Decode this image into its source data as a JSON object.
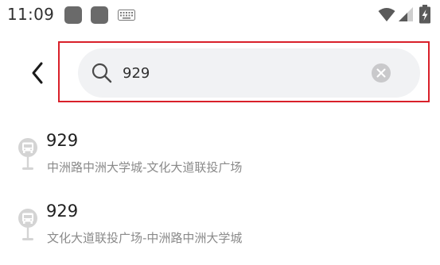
{
  "status_bar": {
    "time": "11:09"
  },
  "search": {
    "query": "929"
  },
  "results": [
    {
      "title": "929",
      "subtitle": "中洲路中洲大学城-文化大道联投广场",
      "icon": "bus-stop-icon"
    },
    {
      "title": "929",
      "subtitle": "文化大道联投广场-中洲路中洲大学城",
      "icon": "bus-stop-icon"
    }
  ],
  "colors": {
    "highlight_border": "#d9202a",
    "search_bg": "#f1f2f4",
    "subtitle_text": "#8a8a8a"
  }
}
